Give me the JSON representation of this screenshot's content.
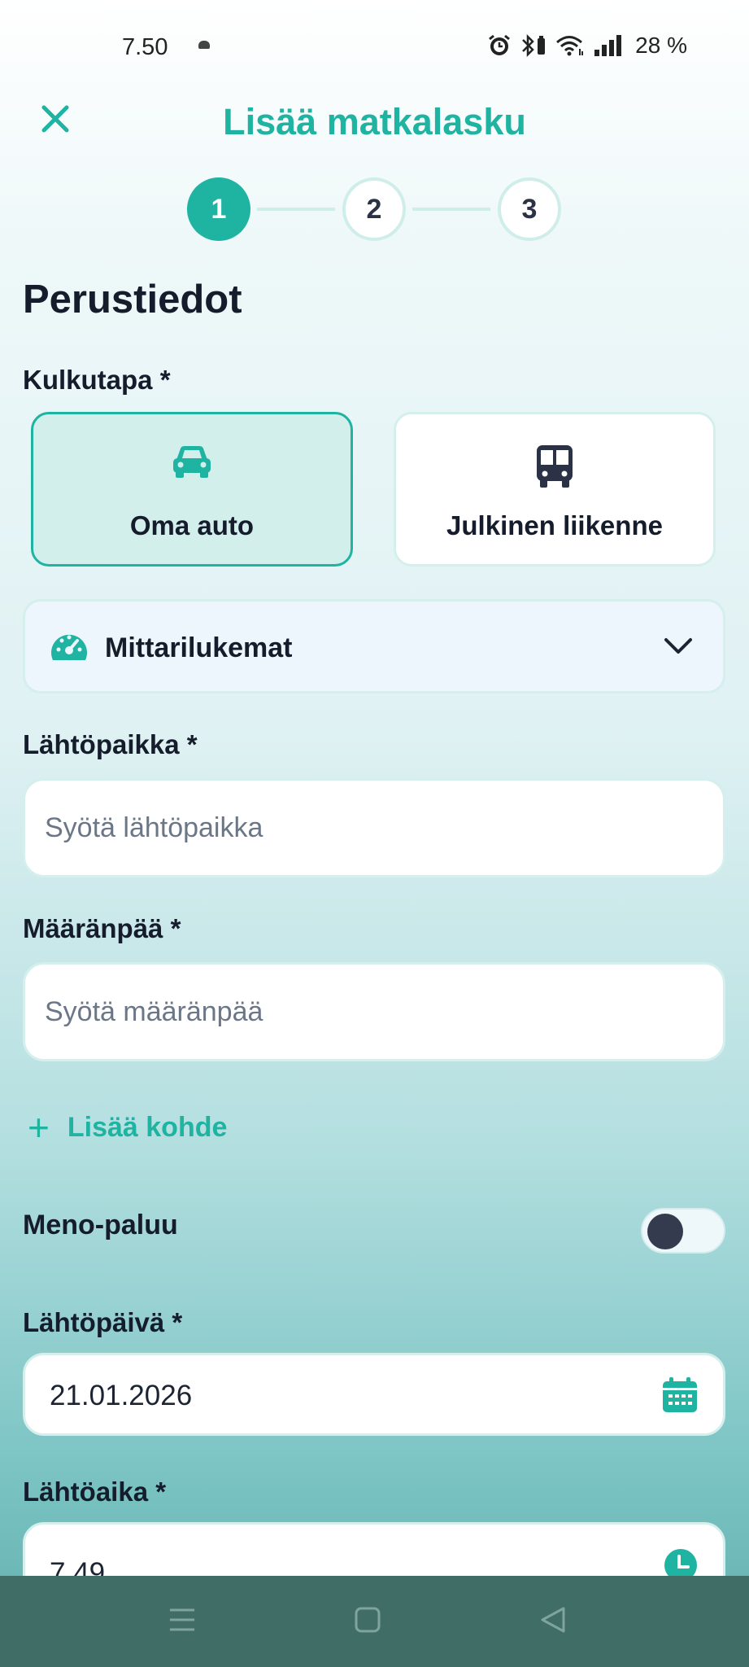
{
  "status_bar": {
    "time": "7.50",
    "battery_percent": "28 %"
  },
  "header": {
    "title": "Lisää matkalasku",
    "close_icon": "close-icon"
  },
  "stepper": {
    "steps": [
      "1",
      "2",
      "3"
    ],
    "active_step": 1
  },
  "section_title": "Perustiedot",
  "transport": {
    "label": "Kulkutapa *",
    "options": [
      {
        "label": "Oma auto",
        "icon": "car-icon",
        "selected": true
      },
      {
        "label": "Julkinen liikenne",
        "icon": "bus-icon",
        "selected": false
      }
    ]
  },
  "odometer": {
    "title": "Mittarilukemat",
    "icon": "gauge-icon",
    "expanded": false
  },
  "departure_place": {
    "label": "Lähtöpaikka *",
    "placeholder": "Syötä lähtöpaikka",
    "value": ""
  },
  "destination": {
    "label": "Määränpää *",
    "placeholder": "Syötä määränpää",
    "value": ""
  },
  "add_destination": {
    "label": "Lisää kohde"
  },
  "round_trip": {
    "label": "Meno-paluu",
    "on": false
  },
  "departure_date": {
    "label": "Lähtöpäivä *",
    "value": "21.01.2026",
    "icon": "calendar-icon"
  },
  "departure_time": {
    "label": "Lähtöaika *",
    "value": "7.49",
    "icon": "clock-icon"
  },
  "colors": {
    "accent": "#1fb3a2",
    "navbar": "#416d67",
    "selected_card": "#d3efec"
  }
}
